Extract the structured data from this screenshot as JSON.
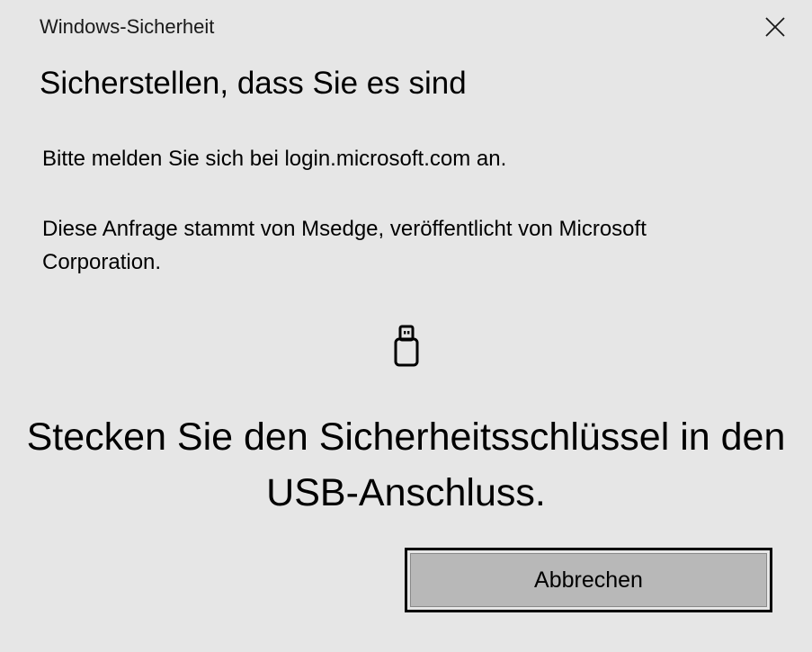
{
  "window": {
    "title": "Windows-Sicherheit",
    "close_icon": "close-icon"
  },
  "dialog": {
    "heading": "Sicherstellen, dass Sie es sind",
    "message_login": "Bitte melden Sie sich bei login.microsoft.com an.",
    "message_request": "Diese Anfrage stammt von Msedge, veröffentlicht von Microsoft Corporation.",
    "icon": "usb-key-icon",
    "instruction": "Stecken Sie den Sicherheitsschlüssel in den USB-Anschluss."
  },
  "buttons": {
    "cancel_label": "Abbrechen"
  },
  "colors": {
    "background": "#e6e6e6",
    "button_fill": "#b8b8b8",
    "button_focus_border": "#000000",
    "text": "#000000"
  }
}
